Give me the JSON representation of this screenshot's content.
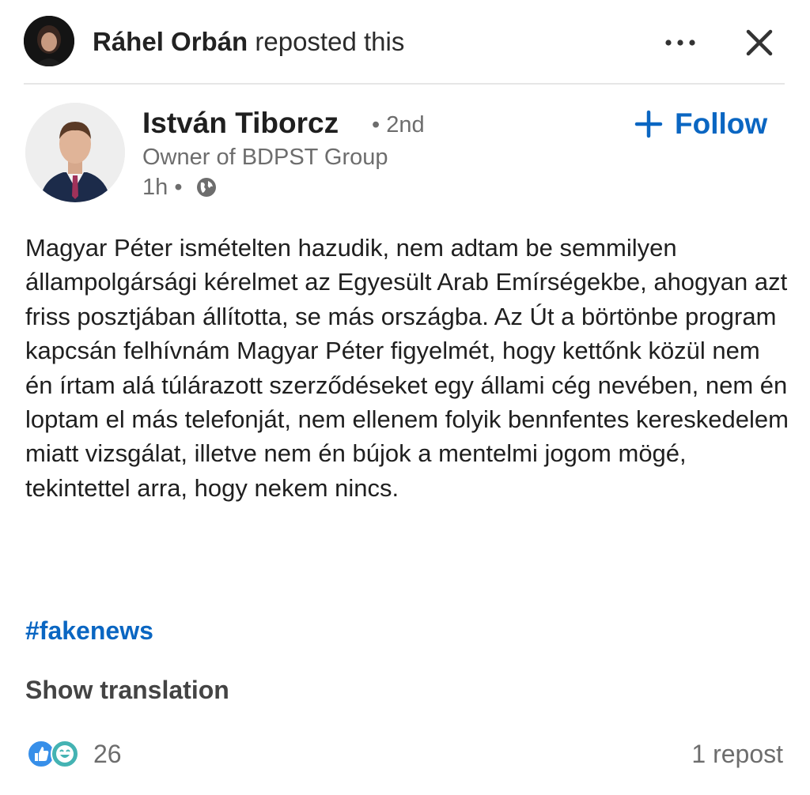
{
  "repost_header": {
    "reposter_name": "Ráhel Orbán",
    "action_text": " reposted this",
    "more_icon": "ellipsis-horizontal",
    "close_icon": "close-x"
  },
  "author": {
    "name": "István Tiborcz",
    "degree": "• 2nd",
    "headline": "Owner of BDPST Group",
    "time_ago": "1h •",
    "visibility_icon": "globe"
  },
  "follow_button": {
    "label": "Follow",
    "icon": "plus"
  },
  "post": {
    "body": "Magyar Péter ismételten hazudik, nem adtam be semmilyen állampolgársági kérelmet az Egyesült Arab Emírségekbe, ahogyan azt friss posztjában állította, se más országba. Az Út a börtönbe program kapcsán felhívnám Magyar Péter figyelmét, hogy kettőnk közül nem én írtam alá túlárazott szerződéseket egy állami cég nevében, nem én loptam el más telefonját, nem ellenem folyik bennfentes kereskedelem miatt vizsgálat, illetve nem én bújok a mentelmi jogom mögé, tekintettel arra, hogy nekem nincs.",
    "hashtag": "#fakenews",
    "show_translation": "Show translation"
  },
  "social": {
    "reaction_count": "26",
    "reaction_icons": [
      "like-icon",
      "funny-icon"
    ],
    "reposts": "1 repost"
  },
  "colors": {
    "accent": "#0a66c2",
    "secondary_text": "#6d6d6d",
    "primary_text": "#1f1f1f",
    "divider": "#e6e6e6"
  }
}
